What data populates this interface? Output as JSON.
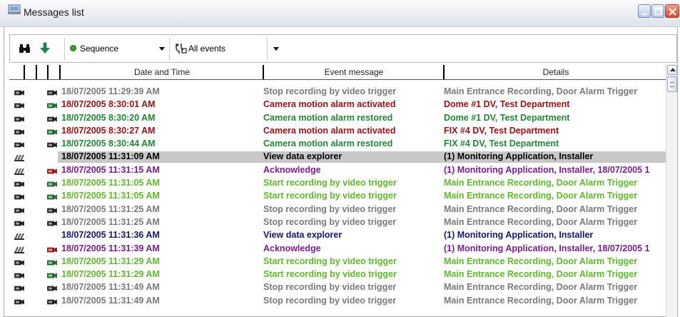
{
  "window": {
    "title": "Messages list"
  },
  "toolbar": {
    "sequence_label": "Sequence",
    "events_label": "All events"
  },
  "columns": {
    "date": "Date and Time",
    "event": "Event message",
    "details": "Details"
  },
  "colors": {
    "gray": "#7a7a7a",
    "red": "#9e0f12",
    "dark_green": "#1d8a33",
    "navy": "#15156e",
    "purple": "#7b1d8d",
    "light_green": "#5fba2a",
    "selection": "#c8c8c8"
  },
  "rows": [
    {
      "icon1": "camera",
      "icon2": "camera-black",
      "color": "gray",
      "date": "18/07/2005 11:29:39 AM",
      "event": "Stop recording by video trigger",
      "details": "Main Entrance Recording, Door Alarm Trigger"
    },
    {
      "icon1": "camera",
      "icon2": "camera-green",
      "color": "red",
      "date": "18/07/2005 8:30:01 AM",
      "event": "Camera motion alarm activated",
      "details": "Dome #1 DV, Test Department"
    },
    {
      "icon1": "camera",
      "icon2": "camera-black",
      "color": "dgreen",
      "date": "18/07/2005 8:30:20 AM",
      "event": "Camera motion alarm restored",
      "details": "Dome #1 DV, Test Department"
    },
    {
      "icon1": "camera",
      "icon2": "camera-green",
      "color": "red",
      "date": "18/07/2005 8:30:27 AM",
      "event": "Camera motion alarm activated",
      "details": "FIX #4 DV, Test Department"
    },
    {
      "icon1": "camera",
      "icon2": "camera-black",
      "color": "dgreen",
      "date": "18/07/2005 8:30:44 AM",
      "event": "Camera motion alarm restored",
      "details": "FIX #4 DV, Test Department"
    },
    {
      "icon1": "stack",
      "icon2": "none",
      "color": "black",
      "selected": true,
      "date": "18/07/2005 11:31:09 AM",
      "event": "View data explorer",
      "details": "(1)  Monitoring Application, Installer"
    },
    {
      "icon1": "stack",
      "icon2": "camera-red",
      "color": "purple",
      "date": "18/07/2005 11:31:15 AM",
      "event": "Acknowledge",
      "details": "(1)  Monitoring Application, Installer, 18/07/2005 1"
    },
    {
      "icon1": "camera",
      "icon2": "camera-green",
      "color": "lgreen",
      "date": "18/07/2005 11:31:05 AM",
      "event": "Start recording by video trigger",
      "details": "Main Entrance Recording, Door Alarm Trigger"
    },
    {
      "icon1": "camera",
      "icon2": "camera-green",
      "color": "lgreen",
      "date": "18/07/2005 11:31:05 AM",
      "event": "Start recording by video trigger",
      "details": "Main Entrance Recording, Door Alarm Trigger"
    },
    {
      "icon1": "camera",
      "icon2": "camera-black",
      "color": "gray",
      "date": "18/07/2005 11:31:25 AM",
      "event": "Stop recording by video trigger",
      "details": "Main Entrance Recording, Door Alarm Trigger"
    },
    {
      "icon1": "camera",
      "icon2": "camera-black",
      "color": "gray",
      "date": "18/07/2005 11:31:25 AM",
      "event": "Stop recording by video trigger",
      "details": "Main Entrance Recording, Door Alarm Trigger"
    },
    {
      "icon1": "stack",
      "icon2": "none",
      "color": "navy",
      "date": "18/07/2005 11:31:36 AM",
      "event": "View data explorer",
      "details": "(1)  Monitoring Application, Installer"
    },
    {
      "icon1": "stack",
      "icon2": "camera-red",
      "color": "purple",
      "date": "18/07/2005 11:31:39 AM",
      "event": "Acknowledge",
      "details": "(1)  Monitoring Application, Installer, 18/07/2005 1"
    },
    {
      "icon1": "camera",
      "icon2": "camera-green",
      "color": "lgreen",
      "date": "18/07/2005 11:31:29 AM",
      "event": "Start recording by video trigger",
      "details": "Main Entrance Recording, Door Alarm Trigger"
    },
    {
      "icon1": "camera",
      "icon2": "camera-green",
      "color": "lgreen",
      "date": "18/07/2005 11:31:29 AM",
      "event": "Start recording by video trigger",
      "details": "Main Entrance Recording, Door Alarm Trigger"
    },
    {
      "icon1": "camera",
      "icon2": "camera-black",
      "color": "gray",
      "date": "18/07/2005 11:31:49 AM",
      "event": "Stop recording by video trigger",
      "details": "Main Entrance Recording, Door Alarm Trigger"
    },
    {
      "icon1": "camera",
      "icon2": "camera-black",
      "color": "gray",
      "date": "18/07/2005 11:31:49 AM",
      "event": "Stop recording by video trigger",
      "details": "Main Entrance Recording, Door Alarm Trigger"
    }
  ]
}
